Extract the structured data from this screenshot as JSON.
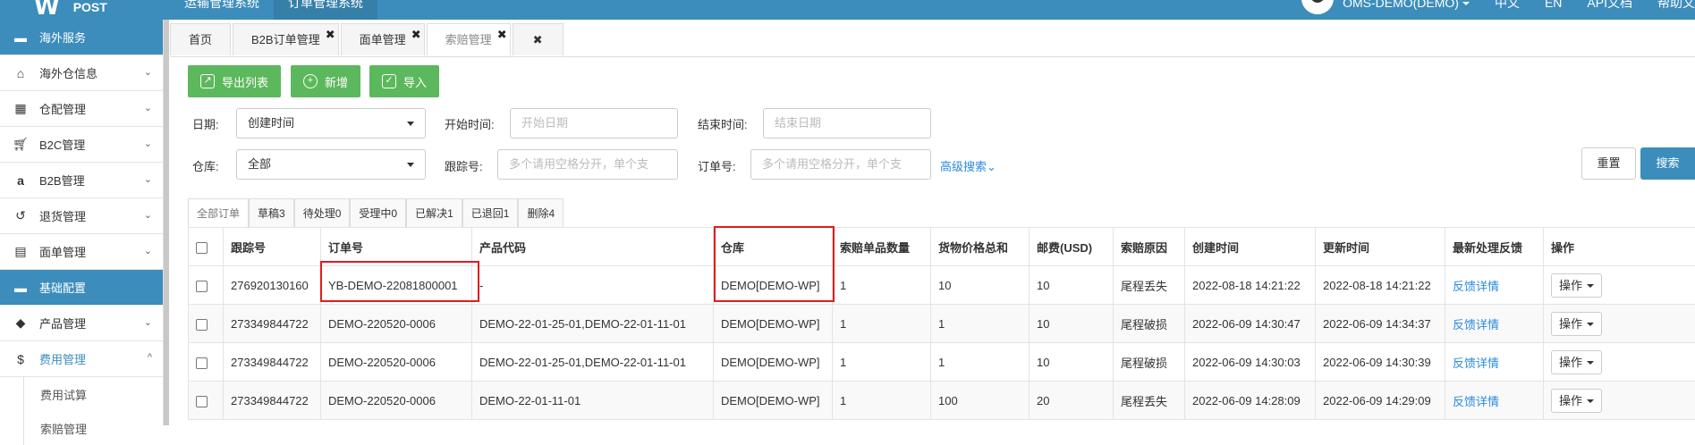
{
  "topbar": {
    "logo_text": "POST",
    "logo_mark": "W",
    "system_tabs": [
      "运输管理系统",
      "订单管理系统"
    ],
    "user": "OMS-DEMO(DEMO)",
    "lang_zh": "中文",
    "lang_en": "EN",
    "api_doc": "API文档",
    "help": "帮助文"
  },
  "sidebar": {
    "items": [
      {
        "label": "海外服务",
        "icon": "folder-icon",
        "type": "header"
      },
      {
        "label": "海外仓信息",
        "icon": "home-icon",
        "chevron": "⌄"
      },
      {
        "label": "仓配管理",
        "icon": "grid-icon",
        "chevron": "⌄"
      },
      {
        "label": "B2C管理",
        "icon": "cart-icon",
        "chevron": "⌄"
      },
      {
        "label": "B2B管理",
        "icon": "amazon-icon",
        "chevron": "⌄"
      },
      {
        "label": "退货管理",
        "icon": "undo-icon",
        "chevron": "⌄"
      },
      {
        "label": "面单管理",
        "icon": "document-icon",
        "chevron": "⌄"
      },
      {
        "label": "基础配置",
        "icon": "folder-icon",
        "type": "header"
      },
      {
        "label": "产品管理",
        "icon": "tag-icon",
        "chevron": "⌄"
      },
      {
        "label": "费用管理",
        "icon": "dollar-icon",
        "chevron": "^",
        "active": true
      }
    ],
    "sub_items": [
      "费用试算",
      "索赔管理"
    ]
  },
  "page_tabs": [
    {
      "label": "首页"
    },
    {
      "label": "B2B订单管理",
      "closable": true
    },
    {
      "label": "面单管理",
      "closable": true
    },
    {
      "label": "索赔管理",
      "closable": true,
      "active": true
    }
  ],
  "close_all": "✖",
  "toolbar": {
    "export": "导出列表",
    "add": "新增",
    "import": "导入"
  },
  "filters": {
    "date_label": "日期:",
    "date_value": "创建时间",
    "start_label": "开始时间:",
    "start_placeholder": "开始日期",
    "end_label": "结束时间:",
    "end_placeholder": "结束日期",
    "warehouse_label": "仓库:",
    "warehouse_value": "全部",
    "tracking_label": "跟踪号:",
    "tracking_placeholder": "多个请用空格分开，单个支",
    "order_label": "订单号:",
    "order_placeholder": "多个请用空格分开，单个支",
    "advanced": "高级搜索⌄",
    "reset": "重置",
    "search": "搜索"
  },
  "status_tabs": [
    "全部订单",
    "草稿3",
    "待处理0",
    "受理中0",
    "已解决1",
    "已退回1",
    "删除4"
  ],
  "table": {
    "headers": [
      "跟踪号",
      "订单号",
      "产品代码",
      "仓库",
      "索赔单品数量",
      "货物价格总和",
      "邮费(USD)",
      "索赔原因",
      "创建时间",
      "更新时间",
      "最新处理反馈",
      "操作"
    ],
    "rows": [
      [
        "276920130160",
        "YB-DEMO-22081800001",
        "-",
        "DEMO[DEMO-WP]",
        "1",
        "10",
        "10",
        "尾程丢失",
        "2022-08-18 14:21:22",
        "2022-08-18 14:21:22",
        "反馈详情",
        "操作"
      ],
      [
        "273349844722",
        "DEMO-220520-0006",
        "DEMO-22-01-25-01,DEMO-22-01-11-01",
        "DEMO[DEMO-WP]",
        "1",
        "1",
        "10",
        "尾程破损",
        "2022-06-09 14:30:47",
        "2022-06-09 14:34:37",
        "反馈详情",
        "操作"
      ],
      [
        "273349844722",
        "DEMO-220520-0006",
        "DEMO-22-01-25-01,DEMO-22-01-11-01",
        "DEMO[DEMO-WP]",
        "1",
        "1",
        "10",
        "尾程破损",
        "2022-06-09 14:30:03",
        "2022-06-09 14:30:39",
        "反馈详情",
        "操作"
      ],
      [
        "273349844722",
        "DEMO-220520-0006",
        "DEMO-22-01-11-01",
        "DEMO[DEMO-WP]",
        "1",
        "100",
        "20",
        "尾程丢失",
        "2022-06-09 14:28:09",
        "2022-06-09 14:29:09",
        "反馈详情",
        "操作"
      ]
    ]
  },
  "colors": {
    "primary": "#3c8dbc",
    "green": "#5cb85c",
    "highlight": "#e21b1b",
    "link": "#2a8ae0"
  }
}
